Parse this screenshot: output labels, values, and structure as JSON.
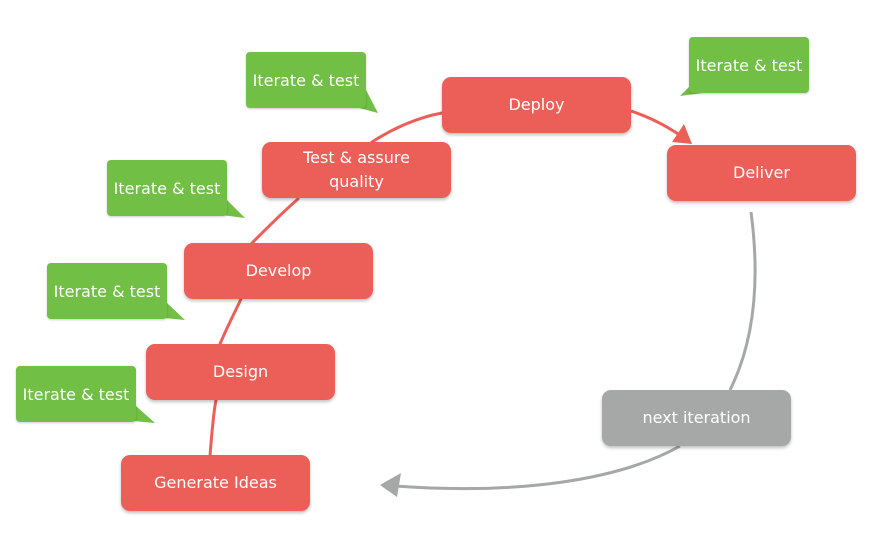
{
  "colors": {
    "stage": "#ec5f59",
    "feedback": "#71bf44",
    "loop": "#a5a8a6"
  },
  "stages": [
    {
      "label": "Generate Ideas"
    },
    {
      "label": "Design"
    },
    {
      "label": "Develop"
    },
    {
      "label": "Test & assure quality"
    },
    {
      "label": "Deploy"
    },
    {
      "label": "Deliver"
    }
  ],
  "loop": {
    "label": "next iteration"
  },
  "feedback": [
    {
      "label": "Iterate & test"
    },
    {
      "label": "Iterate & test"
    },
    {
      "label": "Iterate & test"
    },
    {
      "label": "Iterate & test"
    },
    {
      "label": "Iterate & test"
    }
  ]
}
